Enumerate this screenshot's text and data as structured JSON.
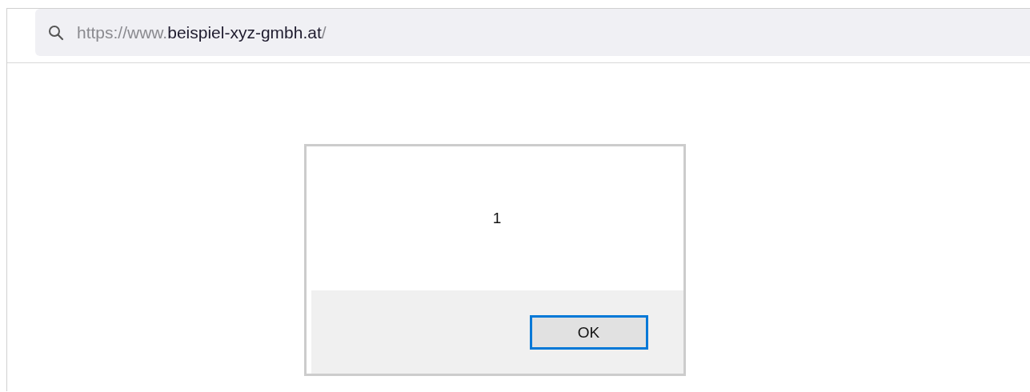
{
  "address_bar": {
    "url_prefix": "https://www.",
    "url_domain": "beispiel-xyz-gmbh.at",
    "url_suffix": "/"
  },
  "dialog": {
    "message": "1",
    "buttons": [
      {
        "label": "OK",
        "focused": true
      }
    ]
  }
}
